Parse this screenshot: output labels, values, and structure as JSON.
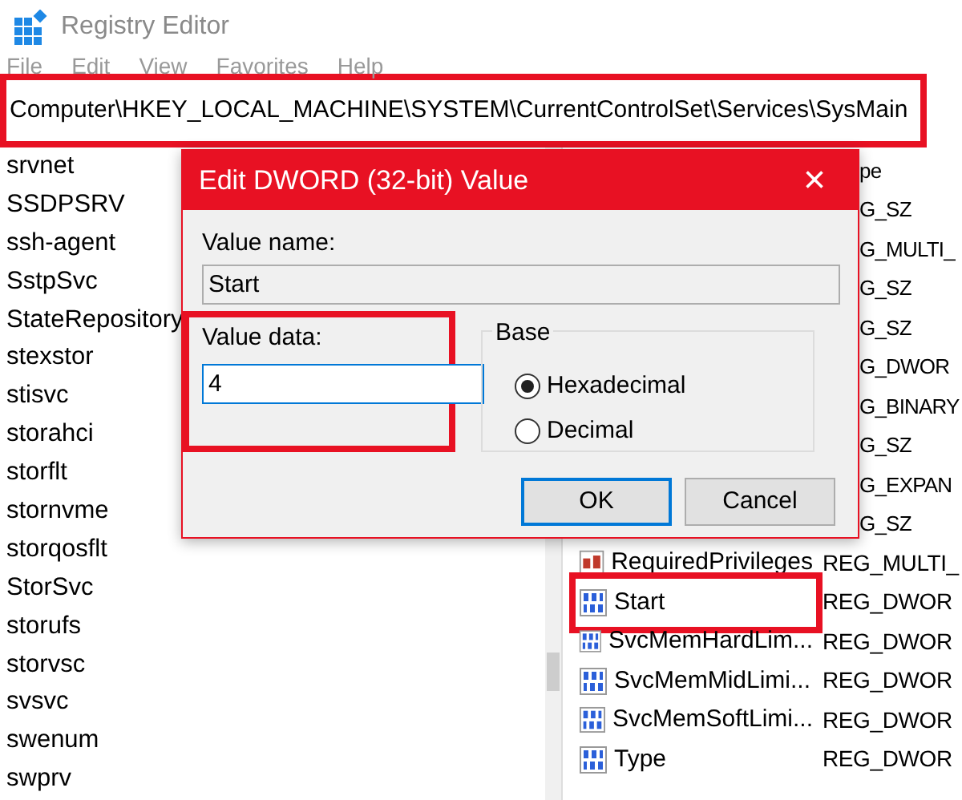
{
  "window": {
    "title": "Registry Editor"
  },
  "menu": [
    "File",
    "Edit",
    "View",
    "Favorites",
    "Help"
  ],
  "address": {
    "value": "Computer\\HKEY_LOCAL_MACHINE\\SYSTEM\\CurrentControlSet\\Services\\SysMain",
    "highlighted": true
  },
  "tree": {
    "items": [
      "srvnet",
      "SSDPSRV",
      "ssh-agent",
      "SstpSvc",
      "StateRepository",
      "stexstor",
      "stisvc",
      "storahci",
      "storflt",
      "stornvme",
      "storqosflt",
      "StorSvc",
      "storufs",
      "storvsc",
      "svsvc",
      "swenum",
      "swprv"
    ]
  },
  "values": {
    "type_header": "pe",
    "rows": [
      {
        "type": "G_SZ"
      },
      {
        "type": "G_MULTI_"
      },
      {
        "type": "G_SZ"
      },
      {
        "type": "G_SZ"
      },
      {
        "type": "G_DWOR"
      },
      {
        "type": "G_BINARY"
      },
      {
        "type": "G_SZ"
      },
      {
        "type": "G_EXPAN"
      },
      {
        "type": "G_SZ"
      },
      {
        "kind": "string",
        "name": "RequiredPrivileges",
        "type": "REG_MULTI_",
        "highlighted": false
      },
      {
        "kind": "binary",
        "name": "Start",
        "type": "REG_DWOR",
        "highlighted": true
      },
      {
        "kind": "binary",
        "name": "SvcMemHardLim...",
        "type": "REG_DWOR",
        "highlighted": false
      },
      {
        "kind": "binary",
        "name": "SvcMemMidLimi...",
        "type": "REG_DWOR",
        "highlighted": false
      },
      {
        "kind": "binary",
        "name": "SvcMemSoftLimi...",
        "type": "REG_DWOR",
        "highlighted": false
      },
      {
        "kind": "binary",
        "name": "Type",
        "type": "REG_DWOR",
        "highlighted": false
      }
    ]
  },
  "dialog": {
    "title": "Edit DWORD (32-bit) Value",
    "close": "×",
    "value_name_label": "Value name:",
    "value_name": "Start",
    "value_data_label": "Value data:",
    "value_data": "4",
    "value_data_highlighted": true,
    "base_label": "Base",
    "base_options": [
      {
        "label": "Hexadecimal",
        "selected": true
      },
      {
        "label": "Decimal",
        "selected": false
      }
    ],
    "buttons": [
      {
        "label": "OK",
        "default": true
      },
      {
        "label": "Cancel",
        "default": false
      }
    ]
  }
}
